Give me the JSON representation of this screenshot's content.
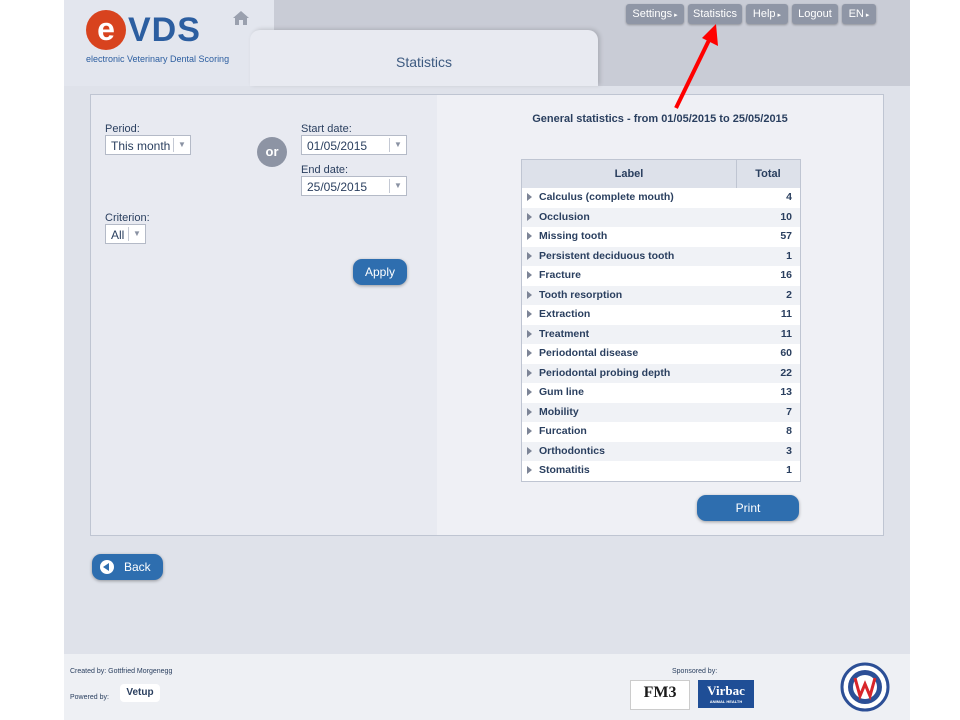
{
  "header": {
    "logo_letter": "e",
    "logo_name": "VDS",
    "logo_tagline": "electronic Veterinary Dental Scoring",
    "page_tab": "Statistics",
    "menu": [
      {
        "label": "Settings"
      },
      {
        "label": "Statistics"
      },
      {
        "label": "Help"
      },
      {
        "label": "Logout"
      },
      {
        "label": "EN"
      }
    ]
  },
  "filters": {
    "period_label": "Period:",
    "period_value": "This month",
    "or_label": "or",
    "start_label": "Start date:",
    "start_value": "01/05/2015",
    "end_label": "End date:",
    "end_value": "25/05/2015",
    "criterion_label": "Criterion:",
    "criterion_value": "All",
    "apply_label": "Apply"
  },
  "stats": {
    "title": "General statistics - from 01/05/2015 to 25/05/2015",
    "col_label": "Label",
    "col_total": "Total",
    "rows": [
      {
        "label": "Calculus (complete mouth)",
        "total": "4"
      },
      {
        "label": "Occlusion",
        "total": "10"
      },
      {
        "label": "Missing tooth",
        "total": "57"
      },
      {
        "label": "Persistent deciduous tooth",
        "total": "1"
      },
      {
        "label": "Fracture",
        "total": "16"
      },
      {
        "label": "Tooth resorption",
        "total": "2"
      },
      {
        "label": "Extraction",
        "total": "11"
      },
      {
        "label": "Treatment",
        "total": "11"
      },
      {
        "label": "Periodontal disease",
        "total": "60"
      },
      {
        "label": "Periodontal probing depth",
        "total": "22"
      },
      {
        "label": "Gum line",
        "total": "13"
      },
      {
        "label": "Mobility",
        "total": "7"
      },
      {
        "label": "Furcation",
        "total": "8"
      },
      {
        "label": "Orthodontics",
        "total": "3"
      },
      {
        "label": "Stomatitis",
        "total": "1"
      }
    ],
    "print_label": "Print"
  },
  "back_label": "Back",
  "footer": {
    "created_by": "Created by: Gottfried Morgenegg",
    "powered_by": "Powered by:",
    "vetup": "Vetup",
    "sponsored_by": "Sponsored by:",
    "sponsor1": "FM3",
    "sponsor2": "Virbac",
    "sponsor2_sub": "ANIMAL HEALTH"
  },
  "colors": {
    "accent_blue": "#2e6eaf",
    "logo_red": "#d8431e",
    "annotation_arrow": "#ff0000"
  }
}
